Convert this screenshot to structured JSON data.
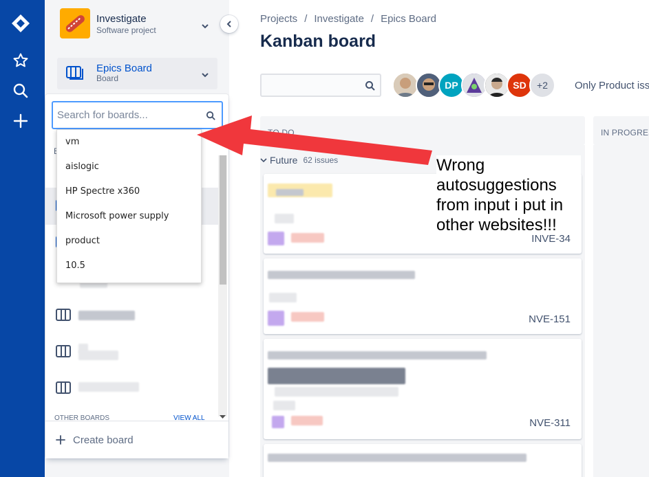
{
  "project": {
    "name": "Investigate",
    "type": "Software project"
  },
  "board_selector": {
    "name": "Epics Board",
    "type": "Board"
  },
  "breadcrumbs": [
    "Projects",
    "Investigate",
    "Epics Board"
  ],
  "breadcrumb_sep": "/",
  "page_title": "Kanban board",
  "avatars": [
    {
      "initials": "",
      "color": "#c8a27a"
    },
    {
      "initials": "",
      "color": "#6b6f7a"
    },
    {
      "initials": "DP",
      "color": "#00a3bf"
    },
    {
      "initials": "",
      "color": "#6c4fa6"
    },
    {
      "initials": "",
      "color": "#3a3f48"
    },
    {
      "initials": "SD",
      "color": "#de350b"
    },
    {
      "initials": "+2",
      "color": "#dfe1e6"
    }
  ],
  "quick_filter": "Only Product iss",
  "columns": [
    {
      "label": "TO DO"
    },
    {
      "label": "IN PROGRES"
    }
  ],
  "swimlane": {
    "label": "Future",
    "count": "62 issues"
  },
  "cards": [
    {
      "key": "INVE-34"
    },
    {
      "key": "NVE-151"
    },
    {
      "key": "NVE-311"
    }
  ],
  "board_search": {
    "placeholder": "Search for boards..."
  },
  "autosuggestions": [
    "vm",
    "aislogic",
    "HP Spectre x360",
    "Microsoft power supply",
    "product",
    "10.5"
  ],
  "boards_partial_label": "E",
  "other_boards": {
    "label": "OTHER BOARDS",
    "view_all": "VIEW ALL"
  },
  "create_board": "Create board",
  "annotation": "Wrong autosuggestions from input i put in other websites!!!",
  "colors": {
    "global_nav": "#0747a6",
    "accent": "#0052cc",
    "arrow": "#f0373c"
  }
}
